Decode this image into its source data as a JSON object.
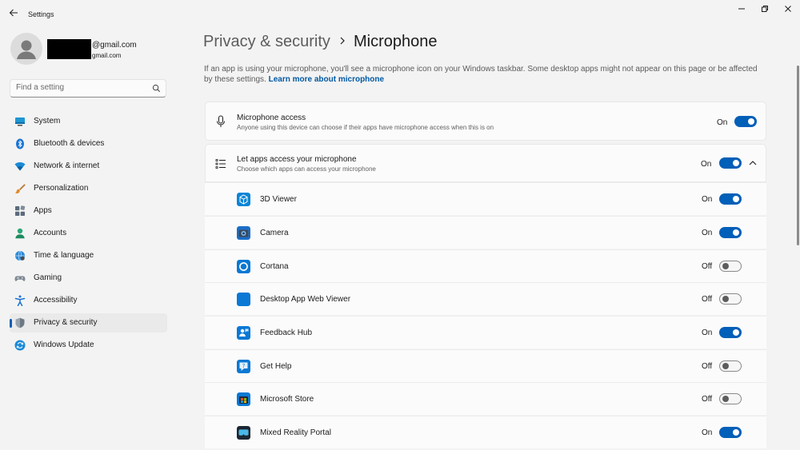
{
  "window": {
    "title": "Settings",
    "controls": {
      "minimize": "minimize-icon",
      "maximize": "restore-icon",
      "close": "close-icon"
    }
  },
  "account": {
    "email": "@gmail.com",
    "email_secondary": "gmail.com"
  },
  "search": {
    "placeholder": "Find a setting"
  },
  "nav": {
    "items": [
      {
        "label": "System",
        "icon": "system-icon"
      },
      {
        "label": "Bluetooth & devices",
        "icon": "bluetooth-icon"
      },
      {
        "label": "Network & internet",
        "icon": "network-icon"
      },
      {
        "label": "Personalization",
        "icon": "brush-icon"
      },
      {
        "label": "Apps",
        "icon": "apps-icon"
      },
      {
        "label": "Accounts",
        "icon": "accounts-icon"
      },
      {
        "label": "Time & language",
        "icon": "globe-icon"
      },
      {
        "label": "Gaming",
        "icon": "gamepad-icon"
      },
      {
        "label": "Accessibility",
        "icon": "accessibility-icon"
      },
      {
        "label": "Privacy & security",
        "icon": "shield-icon",
        "active": true
      },
      {
        "label": "Windows Update",
        "icon": "update-icon"
      }
    ]
  },
  "breadcrumb": {
    "parent": "Privacy & security",
    "current": "Microphone"
  },
  "intro": {
    "text": "If an app is using your microphone, you'll see a microphone icon on your Windows taskbar. Some desktop apps might not appear on this page or be affected by these settings.",
    "link": "Learn more about microphone"
  },
  "microphone_access": {
    "title": "Microphone access",
    "subtitle": "Anyone using this device can choose if their apps have microphone access when this is on",
    "state": "On"
  },
  "let_apps": {
    "title": "Let apps access your microphone",
    "subtitle": "Choose which apps can access your microphone",
    "state": "On"
  },
  "apps": [
    {
      "name": "3D Viewer",
      "state": "On",
      "icon": "3d-viewer-icon"
    },
    {
      "name": "Camera",
      "state": "On",
      "icon": "camera-icon"
    },
    {
      "name": "Cortana",
      "state": "Off",
      "icon": "cortana-icon"
    },
    {
      "name": "Desktop App Web Viewer",
      "state": "Off",
      "icon": "web-viewer-icon"
    },
    {
      "name": "Feedback Hub",
      "state": "On",
      "icon": "feedback-hub-icon"
    },
    {
      "name": "Get Help",
      "state": "Off",
      "icon": "get-help-icon"
    },
    {
      "name": "Microsoft Store",
      "state": "Off",
      "icon": "store-icon"
    },
    {
      "name": "Mixed Reality Portal",
      "state": "On",
      "icon": "mixed-reality-icon"
    }
  ],
  "colors": {
    "accent": "#005fb8",
    "link": "#0058a3",
    "background": "#f3f3f3",
    "card": "#fbfbfb"
  }
}
